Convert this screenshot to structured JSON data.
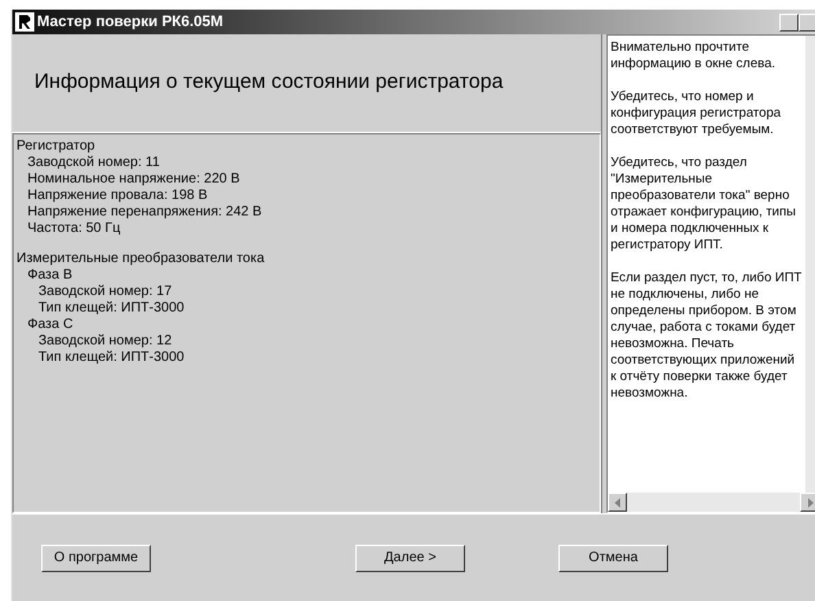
{
  "window": {
    "title": "Мастер поверки РК6.05М"
  },
  "header": {
    "title": "Информация о текущем состоянии регистратора"
  },
  "tree": [
    {
      "label": "Регистратор",
      "children": [
        {
          "label": "Заводской номер: 11"
        },
        {
          "label": "Номинальное напряжение: 220 В"
        },
        {
          "label": "Напряжение провала: 198 В"
        },
        {
          "label": "Напряжение перенапряжения: 242 В"
        },
        {
          "label": "Частота: 50 Гц"
        }
      ]
    },
    {
      "label": "Измерительные преобразователи тока",
      "children": [
        {
          "label": "Фаза В",
          "children": [
            {
              "label": "Заводской номер: 17"
            },
            {
              "label": "Тип клещей: ИПТ-3000"
            }
          ]
        },
        {
          "label": "Фаза С",
          "children": [
            {
              "label": "Заводской номер: 12"
            },
            {
              "label": "Тип клещей: ИПТ-3000"
            }
          ]
        }
      ]
    }
  ],
  "help_paragraphs": [
    "Внимательно прочтите информацию в окне слева.",
    "Убедитесь, что номер и конфигурация регистратора соответствуют требуемым.",
    "Убедитесь, что раздел \"Измерительные преобразователи тока\" верно отражает  конфигурацию, типы и номера подключенных к регистратору ИПТ.",
    "Если раздел пуст, то, либо ИПТ не подключены, либо не определены прибором. В этом случае, работа с токами будет невозможна. Печать соответствующих приложений к отчёту поверки также будет невозможна."
  ],
  "buttons": [
    "О программе",
    "Далее >",
    "Отмена"
  ]
}
